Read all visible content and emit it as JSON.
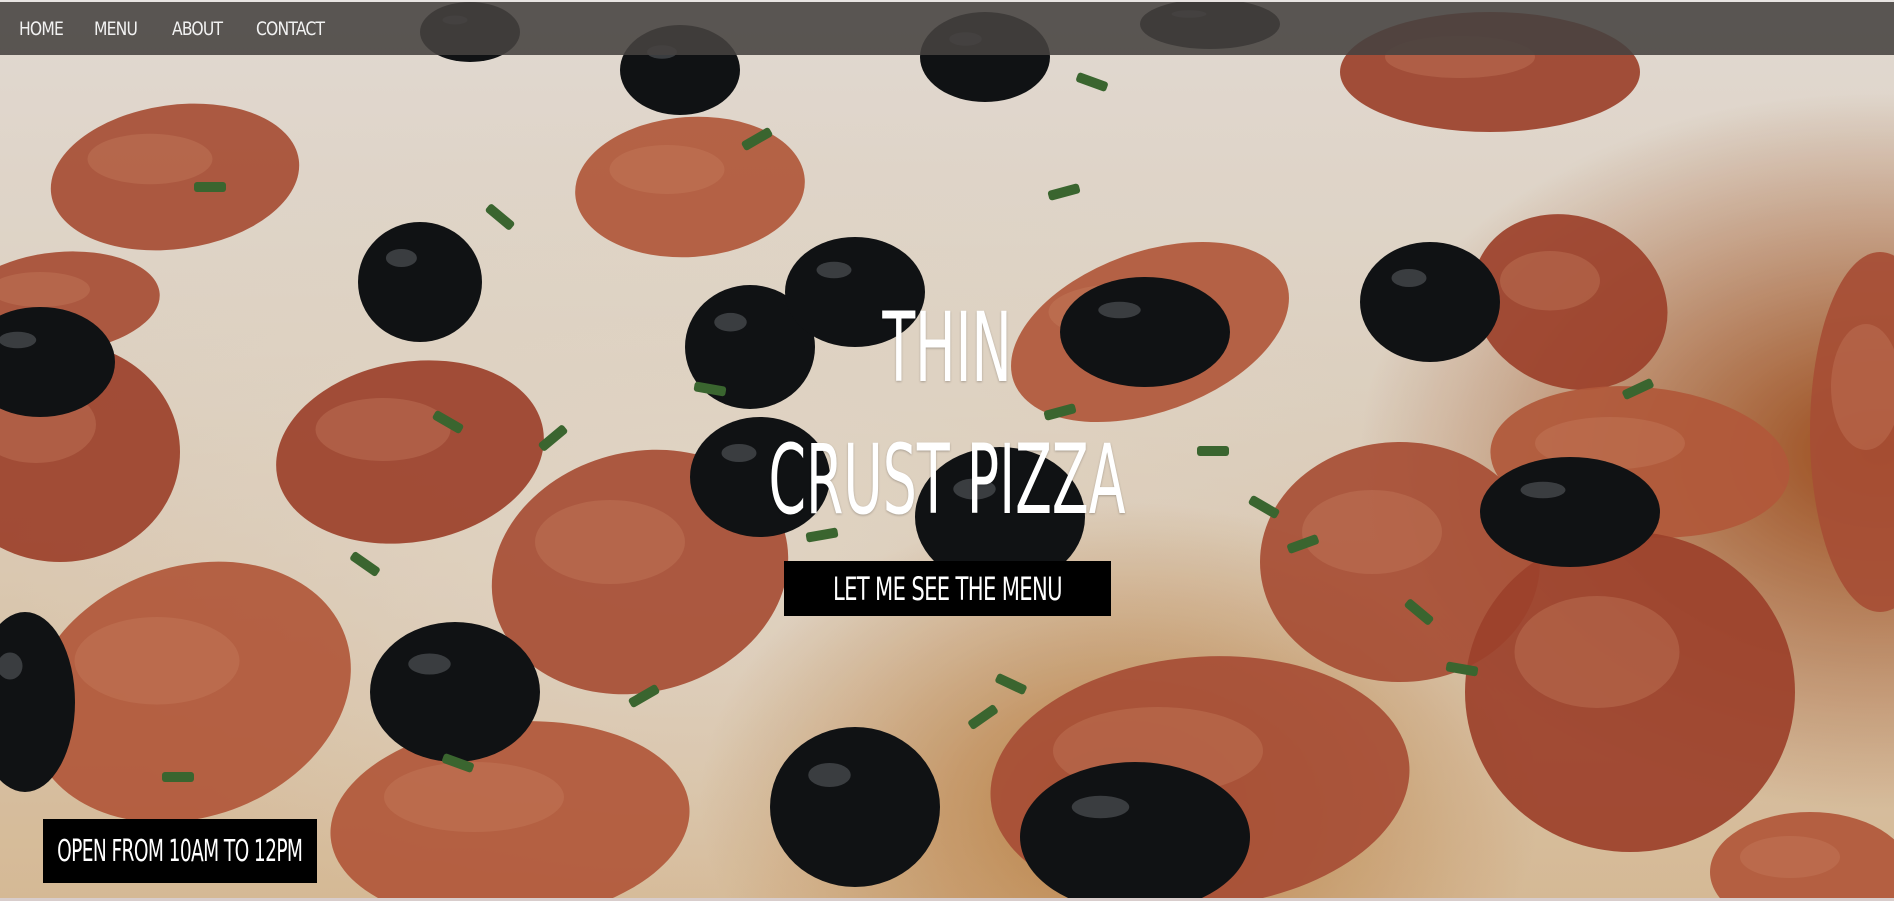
{
  "nav": {
    "items": [
      {
        "label": "Home"
      },
      {
        "label": "Menu"
      },
      {
        "label": "About"
      },
      {
        "label": "Contact"
      }
    ]
  },
  "hero": {
    "title_line_1": "Thin",
    "title_line_2": "Crust Pizza",
    "cta_label": "Let me see the menu",
    "hours_text": "Open from 10am to 12pm",
    "background_image": "pizza-photo"
  },
  "colors": {
    "nav_background": "#464240",
    "nav_text": "#f2f2f2",
    "button_background": "#000000",
    "button_text": "#ffffff",
    "title_text": "#ffffff"
  }
}
